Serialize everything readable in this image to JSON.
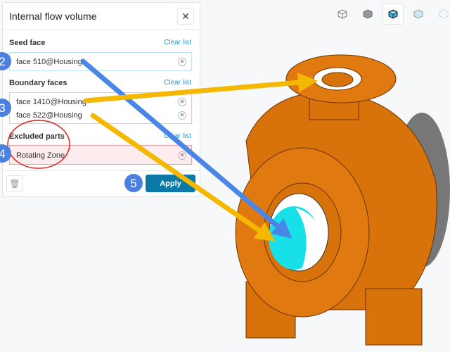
{
  "panel": {
    "title": "Internal flow volume",
    "close_icon": "close-icon",
    "seed": {
      "label": "Seed face",
      "clear": "Clear list",
      "items": [
        "face 510@Housing"
      ]
    },
    "boundary": {
      "label": "Boundary faces",
      "clear": "Clear list",
      "items": [
        "face 1410@Housing",
        "face 522@Housing"
      ]
    },
    "excluded": {
      "label": "Excluded parts",
      "clear": "Clear list",
      "items": [
        "Rotating Zone"
      ]
    },
    "apply": "Apply",
    "trash_icon": "trash-icon"
  },
  "view_tools": [
    "wireframe-cube-icon",
    "solid-cube-icon",
    "shaded-edges-cube-icon",
    "transparent-cube-icon",
    "points-cube-icon"
  ],
  "annotations": {
    "badges": [
      "2",
      "3",
      "4",
      "5"
    ],
    "badge_color": "#4a80e0",
    "arrow_blue": "#4a86e8",
    "arrow_yellow": "#f5b800",
    "circle_color": "#e02020"
  },
  "colors": {
    "model": "#e07a10",
    "accent": "#0b79a8",
    "link": "#2a9bd0"
  }
}
